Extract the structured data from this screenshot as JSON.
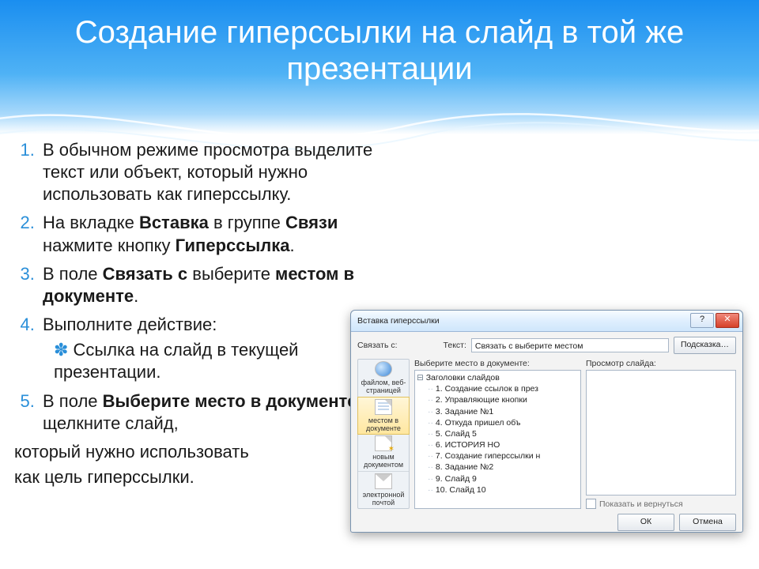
{
  "title": "Создание гиперссылки на слайд в той же презентации",
  "list": {
    "i1_a": "В обычном режиме просмотра выделите текст или объект, который нужно использовать как гиперссылку.",
    "i2_a": "На вкладке ",
    "i2_b": "Вставка",
    "i2_c": " в группе ",
    "i2_d": "Связи",
    "i2_e": " нажмите кнопку ",
    "i2_f": "Гиперссылка",
    "i2_g": ".",
    "i3_a": "В поле ",
    "i3_b": "Связать с",
    "i3_c": " выберите ",
    "i3_d": "местом в документе",
    "i3_e": ".",
    "i4_a": "Выполните действие:",
    "i4_sub": "Ссылка на слайд в текущей презентации.",
    "i5_a": "В поле ",
    "i5_b": "Выберите место в документе",
    "i5_c": " щелкните слайд,",
    "tail1": "который нужно использовать",
    "tail2": "как цель гиперссылки."
  },
  "dialog": {
    "title": "Вставка гиперссылки",
    "help_glyph": "?",
    "close_glyph": "✕",
    "link_with_label": "Связать с:",
    "text_label": "Текст:",
    "text_value": "Связать с выберите местом",
    "hint_button": "Подсказка…",
    "place_label": "Выберите место в документе:",
    "preview_label": "Просмотр слайда:",
    "linkbar": {
      "i1": "файлом, веб-страницей",
      "i2": "местом в документе",
      "i3": "новым документом",
      "i4": "электронной почтой"
    },
    "tree_root": "Заголовки слайдов",
    "tree": [
      "1. Создание ссылок в през",
      "2. Управляющие кнопки",
      "3. Задание №1",
      "4. Откуда пришел        объ",
      "5. Слайд 5",
      "6.           ИСТОРИЯ      НО",
      "7. Создание гиперссылки н",
      "8. Задание №2",
      "9. Слайд 9",
      "10. Слайд 10"
    ],
    "show_return": "Показать и вернуться",
    "ok": "ОК",
    "cancel": "Отмена"
  }
}
